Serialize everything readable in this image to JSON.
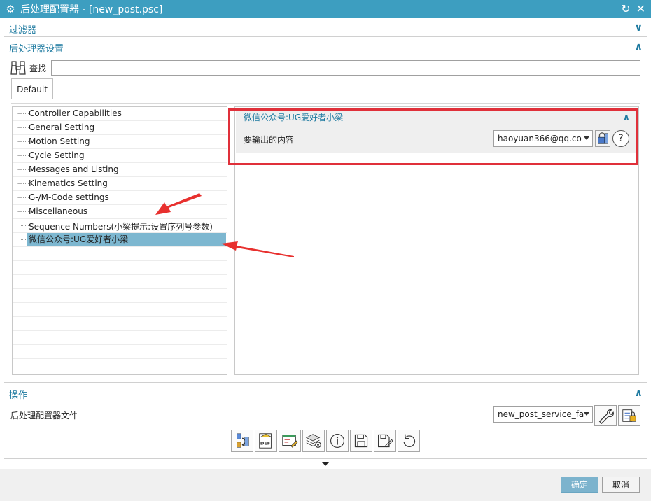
{
  "window": {
    "title": "后处理配置器 - [new_post.psc]"
  },
  "sections": {
    "filter": "过滤器",
    "settings": "后处理器设置",
    "operations": "操作"
  },
  "search": {
    "label": "查找",
    "value": ""
  },
  "tabs": [
    {
      "label": "Default"
    }
  ],
  "tree": {
    "items": [
      {
        "label": "Controller Capabilities",
        "expandable": true
      },
      {
        "label": "General Setting",
        "expandable": true
      },
      {
        "label": "Motion Setting",
        "expandable": true
      },
      {
        "label": "Cycle Setting",
        "expandable": true
      },
      {
        "label": "Messages and Listing",
        "expandable": true
      },
      {
        "label": "Kinematics Setting",
        "expandable": true
      },
      {
        "label": "G-/M-Code settings",
        "expandable": true
      },
      {
        "label": "Miscellaneous",
        "expandable": true
      },
      {
        "label": "Sequence Numbers(小梁提示:设置序列号参数)",
        "expandable": false
      },
      {
        "label": "微信公众号:UG爱好者小梁",
        "expandable": false,
        "selected": true
      }
    ]
  },
  "detail": {
    "group_title": "微信公众号:UG爱好者小梁",
    "field_label": "要输出的内容",
    "field_value": "haoyuan366@qq.co"
  },
  "operations": {
    "file_label": "后处理配置器文件",
    "file_value": "new_post_service_fa"
  },
  "buttons": {
    "ok": "确定",
    "cancel": "取消"
  },
  "colors": {
    "title_bar": "#3d9ec0",
    "accent_text": "#1e7aa0",
    "selection": "#7db7d0",
    "highlight_box": "#e0303a",
    "annotation_arrow": "#e8302e"
  }
}
